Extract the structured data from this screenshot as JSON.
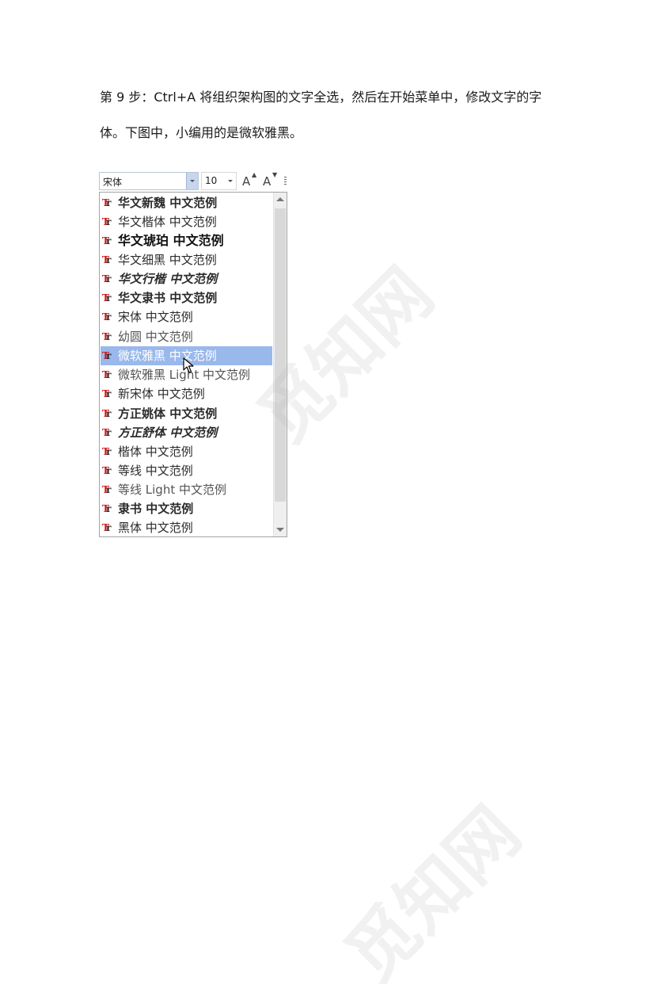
{
  "paragraph": {
    "line1": "第 9 步：Ctrl+A 将组织架构图的文字全选，然后在开始菜单中，修改文字的字",
    "line2": "体。下图中，小编用的是微软雅黑。"
  },
  "toolbar": {
    "font_value": "宋体",
    "size_value": "10",
    "grow_label": "A",
    "shrink_label": "A"
  },
  "font_list": {
    "items": [
      {
        "label": "华文新魏  中文范例"
      },
      {
        "label": "华文楷体  中文范例"
      },
      {
        "label": "华文琥珀  中文范例"
      },
      {
        "label": "华文细黑  中文范例"
      },
      {
        "label": "华文行楷  中文范例"
      },
      {
        "label": "华文隶书  中文范例"
      },
      {
        "label": "宋体    中文范例"
      },
      {
        "label": "幼圆    中文范例"
      },
      {
        "label": "微软雅黑  中文范例",
        "selected": true
      },
      {
        "label": "微软雅黑 Light  中文范例"
      },
      {
        "label": "新宋体    中文范例"
      },
      {
        "label": "方正姚体  中文范例"
      },
      {
        "label": "方正舒体  中文范例"
      },
      {
        "label": "楷体    中文范例"
      },
      {
        "label": "等线  中文范例"
      },
      {
        "label": "等线 Light  中文范例"
      },
      {
        "label": "隶书    中文范例"
      },
      {
        "label": "黑体    中文范例"
      }
    ],
    "icon_text": "Tr"
  },
  "watermark": {
    "text": "觅知网"
  },
  "colors": {
    "selection": "#99b8ec",
    "icon_red": "#d01616"
  }
}
